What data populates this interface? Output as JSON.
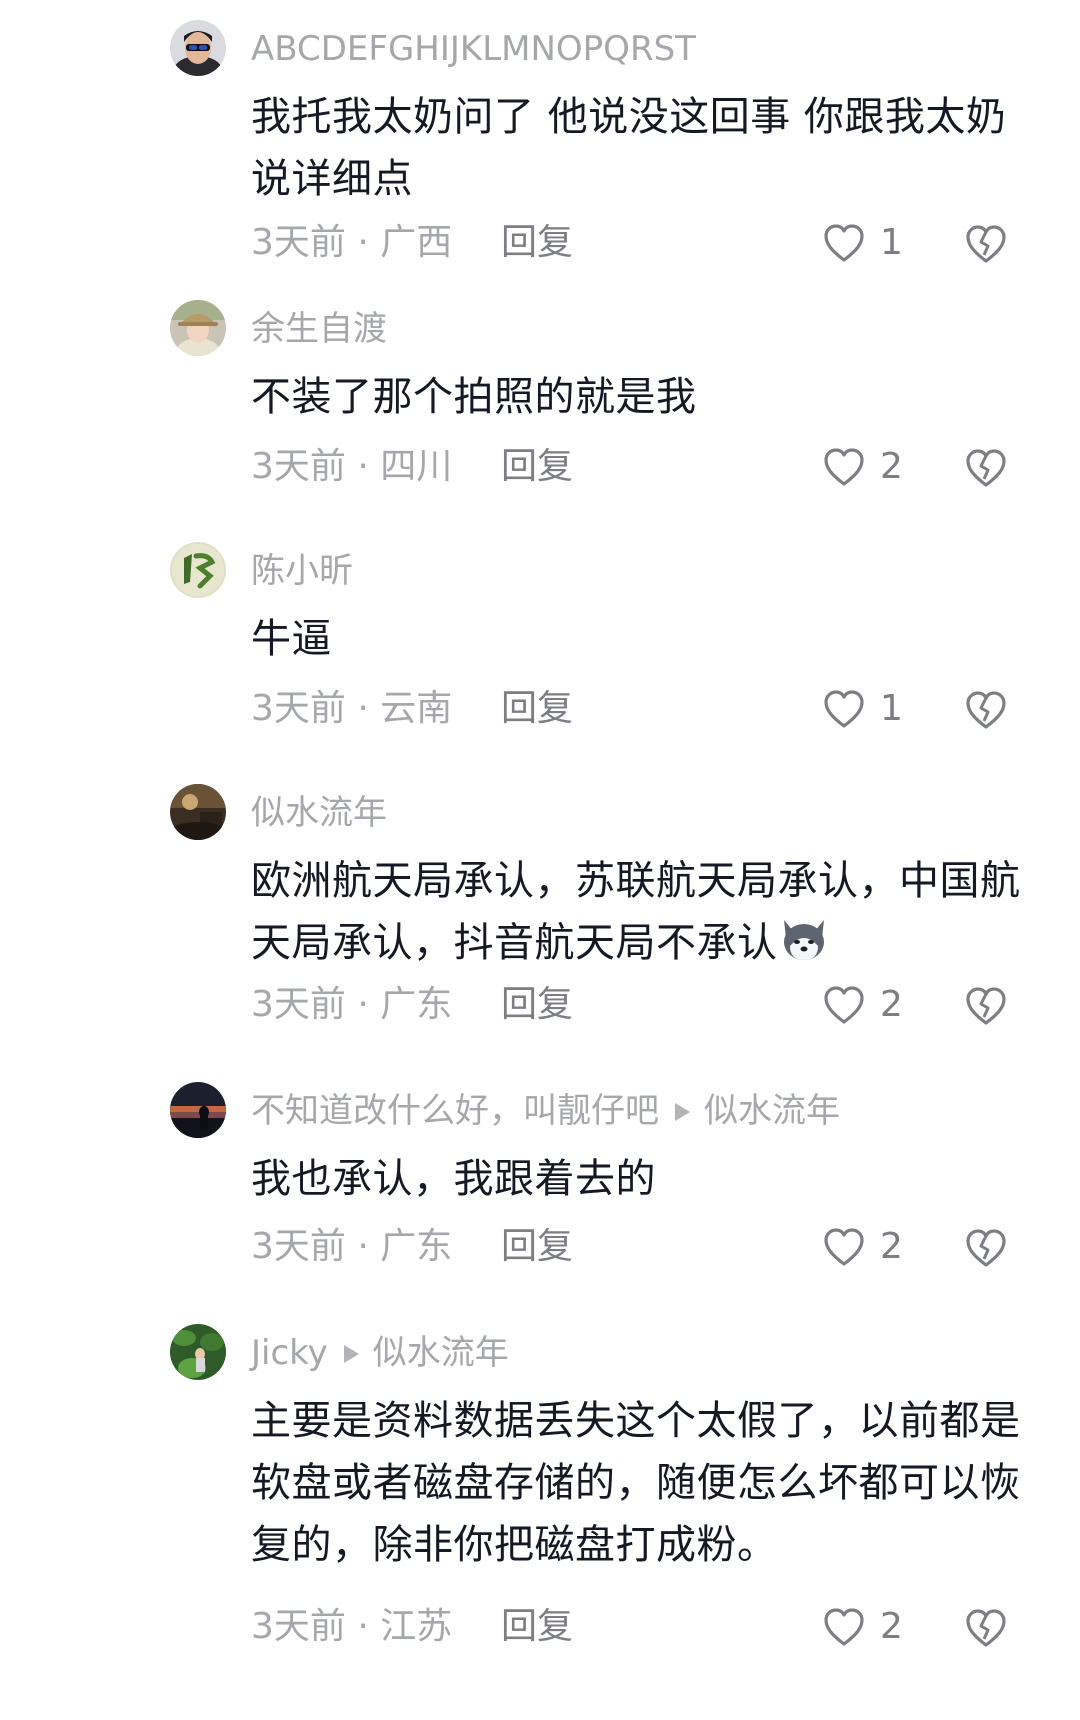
{
  "reply_label": "回复",
  "comments": [
    {
      "username": "ABCDEFGHIJKLMNOPQRST",
      "reply_to": "",
      "text": "我托我太奶问了 他说没这回事 你跟我太奶说详细点",
      "time_location": "3天前 · 广西",
      "likes": "1",
      "avatar_icon": "avatar-man-sunglasses"
    },
    {
      "username": "余生自渡",
      "reply_to": "",
      "text": "不装了那个拍照的就是我",
      "time_location": "3天前 · 四川",
      "likes": "2",
      "avatar_icon": "avatar-girl-hat"
    },
    {
      "username": "陈小昕",
      "reply_to": "",
      "text": "牛逼",
      "time_location": "3天前 · 云南",
      "likes": "1",
      "avatar_icon": "avatar-calligraphy-chen"
    },
    {
      "username": "似水流年",
      "reply_to": "",
      "text": "欧洲航天局承认，苏联航天局承认，中国航天局承认，抖音航天局不承认",
      "emoji": "husky-emoji",
      "time_location": "3天前 · 广东",
      "likes": "2",
      "avatar_icon": "avatar-night-scene"
    },
    {
      "username": "不知道改什么好，叫靓仔吧",
      "reply_to": "似水流年",
      "text": "我也承认，我跟着去的",
      "time_location": "3天前 · 广东",
      "likes": "2",
      "avatar_icon": "avatar-sunset-silhouette"
    },
    {
      "username": "Jicky",
      "reply_to": "似水流年",
      "text": "主要是资料数据丢失这个太假了，以前都是软盘或者磁盘存储的，随便怎么坏都可以恢复的，除非你把磁盘打成粉。",
      "time_location": "3天前 · 江苏",
      "likes": "2",
      "avatar_icon": "avatar-green-leaves"
    }
  ],
  "colors": {
    "text": "#161823",
    "meta": "#a6a7ab",
    "action": "#7d7e83",
    "background": "#ffffff"
  }
}
